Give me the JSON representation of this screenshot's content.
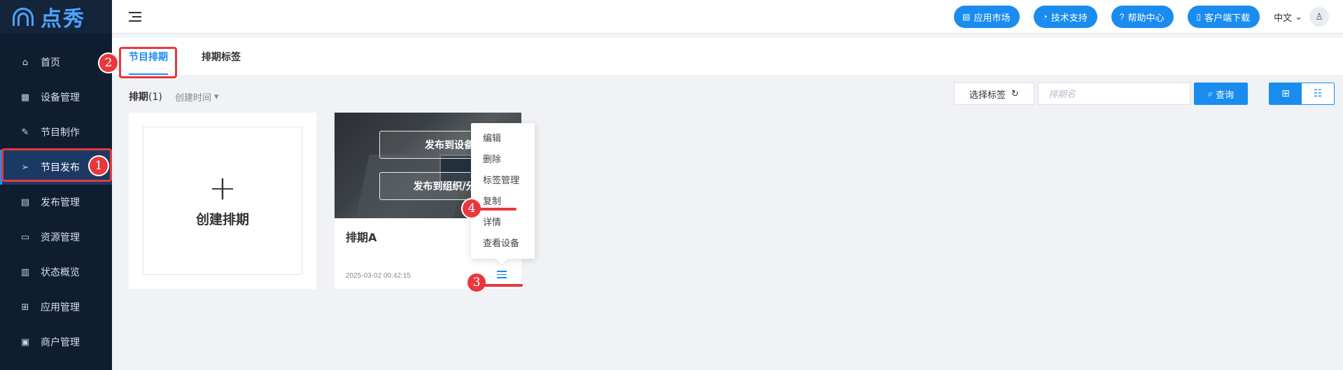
{
  "app": {
    "logo_text": "点秀"
  },
  "sidebar": {
    "items": [
      {
        "label": "首页",
        "icon": "home-icon",
        "glyph": "⌂"
      },
      {
        "label": "设备管理",
        "icon": "device-icon",
        "glyph": "▦"
      },
      {
        "label": "节目制作",
        "icon": "edit-icon",
        "glyph": "✎"
      },
      {
        "label": "节目发布",
        "icon": "send-icon",
        "glyph": "➢",
        "active": true
      },
      {
        "label": "发布管理",
        "icon": "list-icon",
        "glyph": "▤"
      },
      {
        "label": "资源管理",
        "icon": "folder-icon",
        "glyph": "▭"
      },
      {
        "label": "状态概览",
        "icon": "chart-icon",
        "glyph": "▥"
      },
      {
        "label": "应用管理",
        "icon": "apps-icon",
        "glyph": "⊞"
      },
      {
        "label": "商户管理",
        "icon": "merchant-icon",
        "glyph": "▣"
      }
    ]
  },
  "header": {
    "buttons": [
      {
        "label": "应用市场",
        "icon": "store-icon",
        "glyph": "▤"
      },
      {
        "label": "技术支持",
        "icon": "support-icon",
        "glyph": "◔"
      },
      {
        "label": "帮助中心",
        "icon": "help-icon",
        "glyph": "?"
      },
      {
        "label": "客户端下载",
        "icon": "mobile-icon",
        "glyph": "▯"
      }
    ],
    "language": "中文"
  },
  "tabs": [
    {
      "label": "节目排期",
      "active": true
    },
    {
      "label": "排期标签",
      "active": false
    }
  ],
  "toolbar": {
    "count_label": "排期",
    "count_value": "(1)",
    "sort_label": "创建时间",
    "tag_select_label": "选择标签",
    "search_placeholder": "排期名",
    "query_label": "查询"
  },
  "create_card": {
    "label": "创建排期"
  },
  "schedule_card": {
    "name": "排期A",
    "created_at": "2025-03-02 00:42:15",
    "overlay_buttons": [
      "发布到设备",
      "发布到组织/分组"
    ]
  },
  "context_menu": {
    "items": [
      "编辑",
      "删除",
      "标签管理",
      "复制",
      "详情",
      "查看设备"
    ]
  },
  "annotations": {
    "steps": [
      "1",
      "2",
      "3",
      "4"
    ],
    "color": "#e8383d"
  },
  "colors": {
    "accent": "#1a8cf0",
    "sidebar_bg": "#0f1d31"
  }
}
